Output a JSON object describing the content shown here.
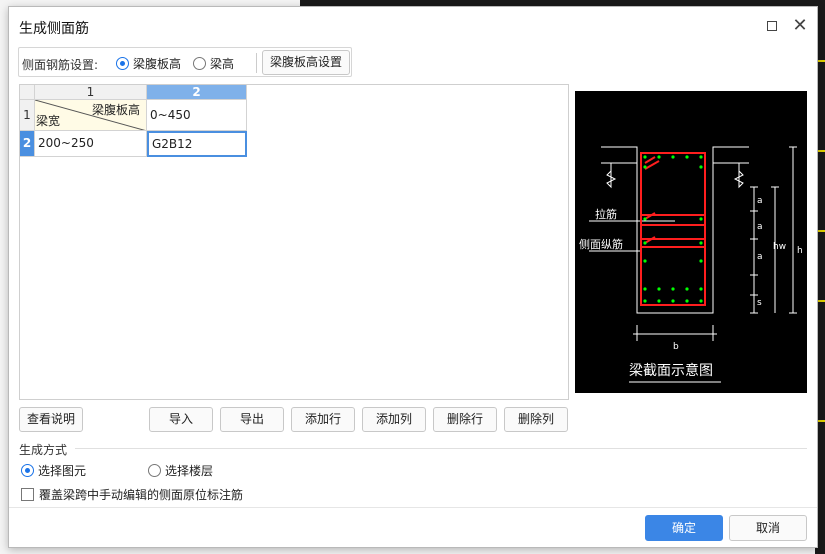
{
  "dialog": {
    "title": "生成侧面筋"
  },
  "settings": {
    "label": "侧面钢筋设置:",
    "options": [
      {
        "label": "梁腹板高",
        "selected": true
      },
      {
        "label": "梁高",
        "selected": false
      }
    ],
    "config_button": "梁腹板高设置"
  },
  "table": {
    "col_headers": [
      "1",
      "2"
    ],
    "row_headers": [
      "1",
      "2"
    ],
    "corner_top": "梁腹板高",
    "corner_bottom": "梁宽",
    "rows": [
      {
        "c1": "",
        "c2": "0~450"
      },
      {
        "c1": "200~250",
        "c2": "G2B12"
      }
    ]
  },
  "actions": {
    "help": "查看说明",
    "import": "导入",
    "export": "导出",
    "add_row": "添加行",
    "add_col": "添加列",
    "del_row": "删除行",
    "del_col": "删除列"
  },
  "diagram": {
    "caption": "梁截面示意图",
    "label_tie": "拉筋",
    "label_side": "侧面纵筋",
    "dim_a": "a",
    "dim_hw": "hw",
    "dim_h": "h",
    "dim_s": "s",
    "dim_b": "b"
  },
  "generate": {
    "section_label": "生成方式",
    "options": [
      {
        "label": "选择图元",
        "selected": true
      },
      {
        "label": "选择楼层",
        "selected": false
      }
    ],
    "override_label": "覆盖梁跨中手动编辑的侧面原位标注筋",
    "override_checked": false
  },
  "footer": {
    "ok": "确定",
    "cancel": "取消"
  },
  "colors": {
    "accent": "#3b86e6",
    "rebar": "#ff1e1e",
    "bar_dot": "#00ff00"
  }
}
